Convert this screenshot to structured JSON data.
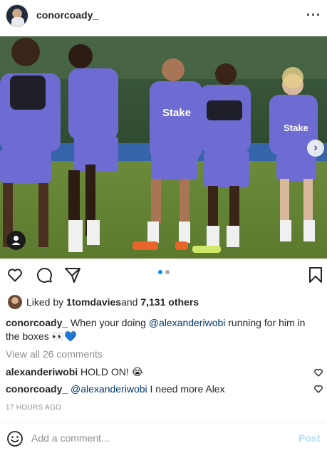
{
  "post": {
    "username": "conorcoady_",
    "more_icon": "more-horizontal-icon"
  },
  "carousel": {
    "slide_count": 2,
    "active_index": 0,
    "next_icon": "chevron-right-icon",
    "tag_icon": "user-tag-icon"
  },
  "actions": {
    "like_icon": "heart-outline-icon",
    "comment_icon": "comment-bubble-icon",
    "share_icon": "paper-plane-icon",
    "save_icon": "bookmark-icon"
  },
  "likes": {
    "prefix": "Liked by ",
    "liker": "1tomdavies",
    "connector": " and ",
    "others": "7,131 others"
  },
  "caption": {
    "username": "conorcoady_",
    "text_before": " When your doing ",
    "mention": "@alexanderiwobi",
    "text_after": " running for him in the boxes 👀💙"
  },
  "comments_link": "View all 26 comments",
  "comments": [
    {
      "username": "alexanderiwobi",
      "text": " HOLD ON! 😭"
    },
    {
      "username": "conorcoady_",
      "mention": "@alexanderiwobi",
      "text": " I need more Alex"
    }
  ],
  "timestamp": "17 HOURS AGO",
  "composer": {
    "placeholder": "Add a comment...",
    "post_label": "Post"
  },
  "colors": {
    "accent": "#0095f6",
    "post_disabled": "#b2dffc",
    "mention": "#00376b",
    "kit_purple": "#6e6cd2"
  }
}
